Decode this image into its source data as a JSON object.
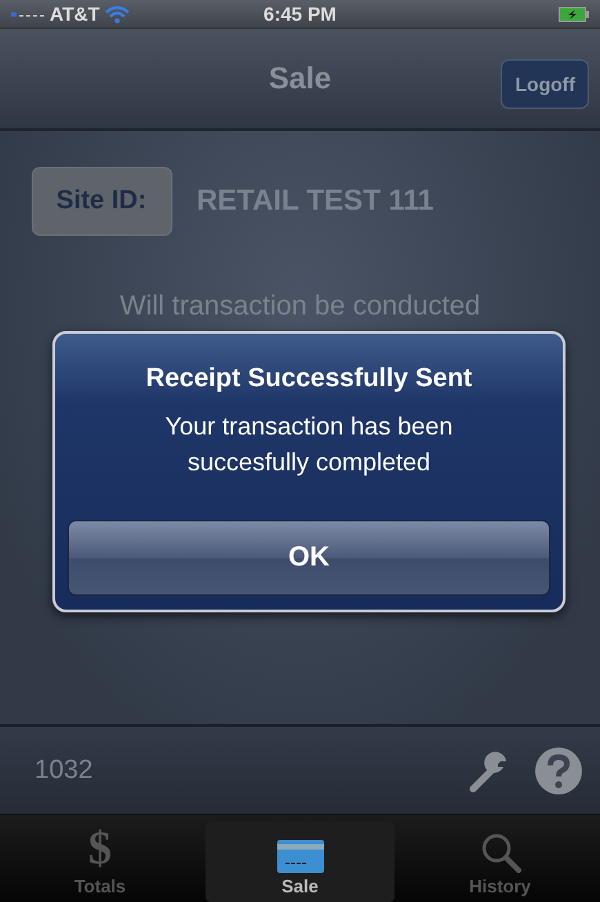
{
  "status_bar": {
    "carrier": "AT&T",
    "time": "6:45 PM"
  },
  "nav_bar": {
    "title": "Sale",
    "right_button": "Logoff"
  },
  "site": {
    "label": "Site ID:",
    "value": "RETAIL TEST 111"
  },
  "question": "Will transaction be conducted",
  "alert": {
    "title": "Receipt Successfully Sent",
    "message": "Your transaction has been succesfully completed",
    "button": "OK"
  },
  "footer": {
    "number": "1032"
  },
  "tabs": [
    {
      "kind": "dollar",
      "glyph": "$",
      "label": "Totals",
      "selected": false
    },
    {
      "kind": "card",
      "label": "Sale",
      "selected": true
    },
    {
      "kind": "search",
      "label": "History",
      "selected": false
    }
  ]
}
